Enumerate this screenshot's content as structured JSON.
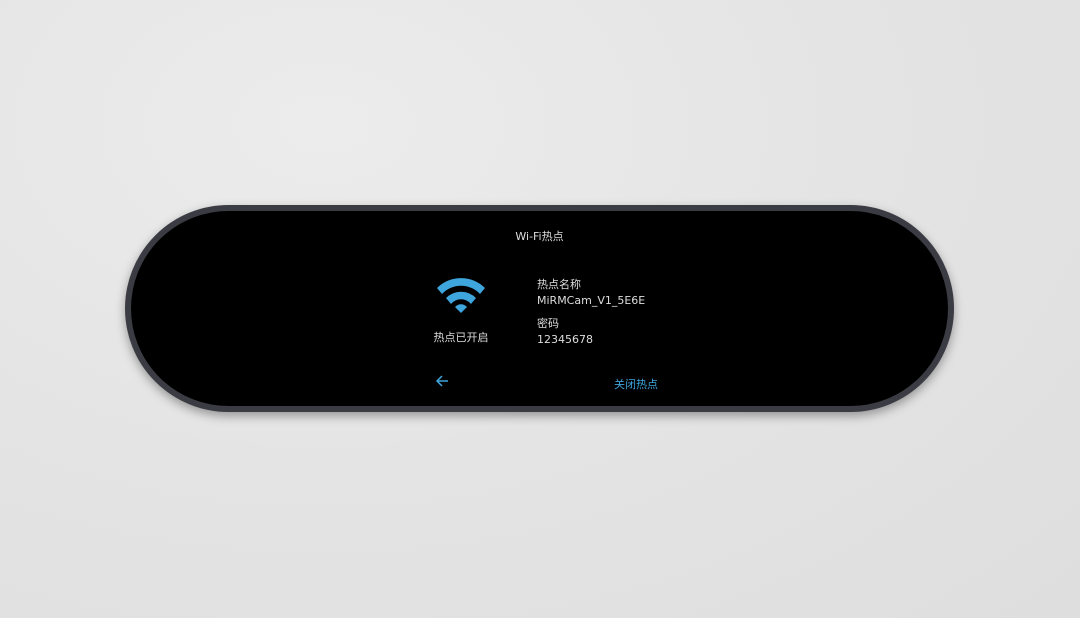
{
  "title": "Wi-Fi热点",
  "status": "热点已开启",
  "hotspot_name_label": "热点名称",
  "hotspot_name": "MiRMCam_V1_5E6E",
  "password_label": "密码",
  "password": "12345678",
  "close_hotspot_label": "关闭热点",
  "icons": {
    "wifi": "wifi-icon",
    "back": "back-arrow-icon"
  },
  "colors": {
    "accent": "#3ea5dd"
  }
}
